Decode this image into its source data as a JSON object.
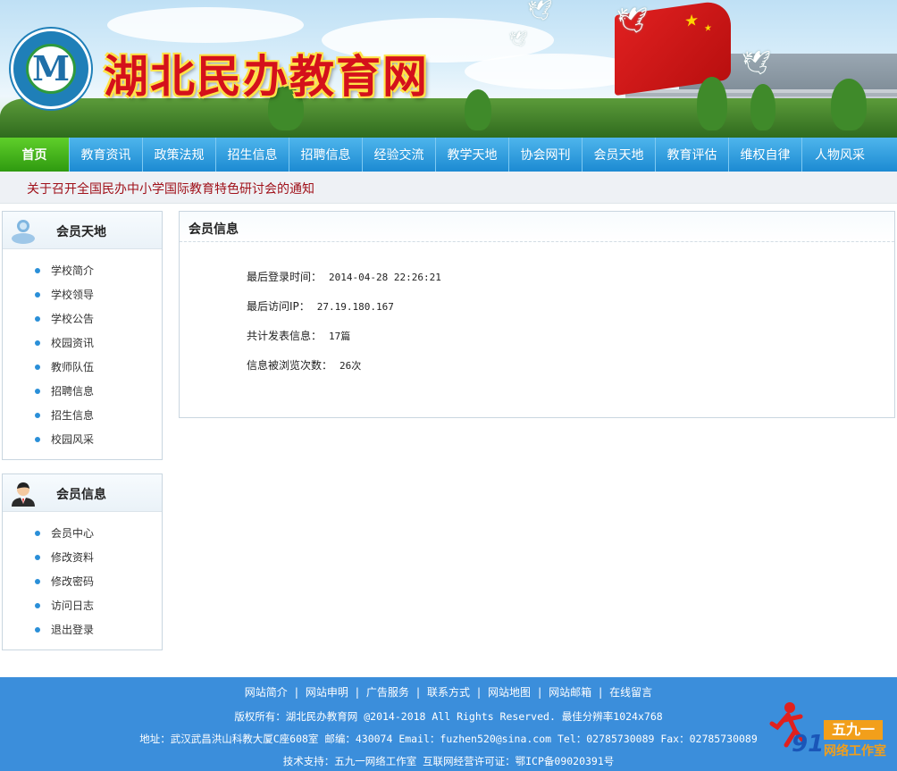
{
  "header": {
    "logo_letter": "M",
    "site_title": "湖北民办教育网"
  },
  "nav": {
    "items": [
      "首页",
      "教育资讯",
      "政策法规",
      "招生信息",
      "招聘信息",
      "经验交流",
      "教学天地",
      "协会网刊",
      "会员天地",
      "教育评估",
      "维权自律",
      "人物风采"
    ],
    "active_index": 0
  },
  "notice": {
    "text": "关于召开全国民办中小学国际教育特色研讨会的通知",
    "color": "#a0111a"
  },
  "sidebar": {
    "member_area": {
      "title": "会员天地",
      "items": [
        "学校简介",
        "学校领导",
        "学校公告",
        "校园资讯",
        "教师队伍",
        "招聘信息",
        "招生信息",
        "校园风采"
      ]
    },
    "member_info": {
      "title": "会员信息",
      "items": [
        "会员中心",
        "修改资料",
        "修改密码",
        "访问日志",
        "退出登录"
      ]
    }
  },
  "main": {
    "title": "会员信息",
    "rows": [
      {
        "label": "最后登录时间：",
        "value": "2014-04-28 22:26:21"
      },
      {
        "label": "最后访问IP：",
        "value": "27.19.180.167"
      },
      {
        "label": "共计发表信息：",
        "value": "17篇"
      },
      {
        "label": "信息被浏览次数：",
        "value": "26次"
      }
    ]
  },
  "footer": {
    "links": [
      "网站简介",
      "网站申明",
      "广告服务",
      "联系方式",
      "网站地图",
      "网站邮箱",
      "在线留言"
    ],
    "copyright": "版权所有：湖北民办教育网 @2014-2018 All Rights Reserved. 最佳分辨率1024x768",
    "address": "地址：武汉武昌洪山科教大厦C座608室 邮编：430074 Email：fuzhen520@sina.com Tel：02785730089 Fax：02785730089",
    "support": "技术支持：五九一网络工作室 互联网经营许可证：鄂ICP备09020391号",
    "watermark": {
      "num": "91",
      "badge": "五九一",
      "sub": "网络工作室"
    },
    "bg_color": "#3b8edb"
  }
}
